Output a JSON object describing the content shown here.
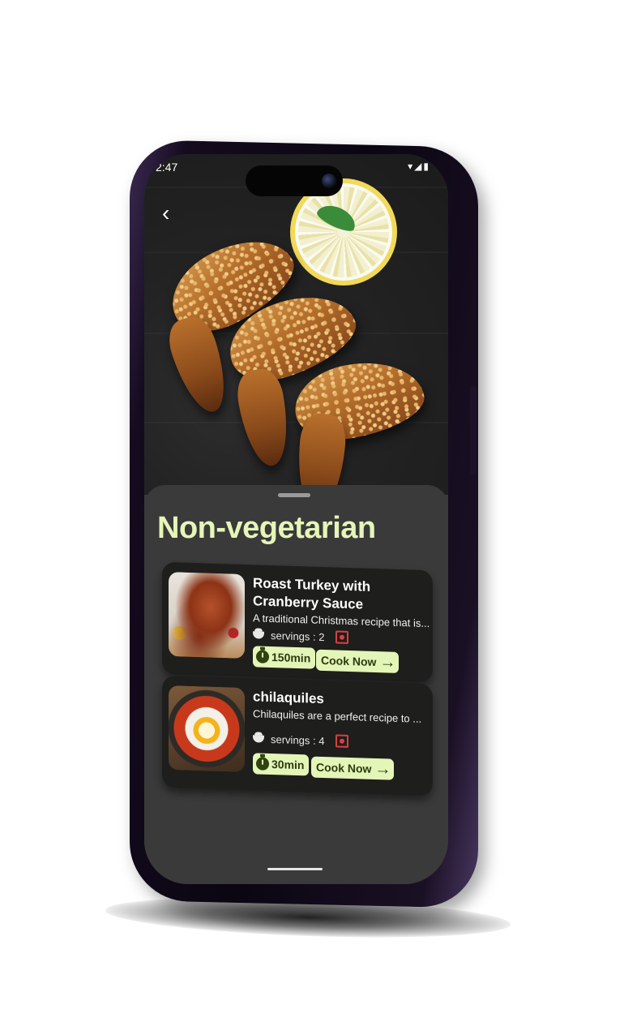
{
  "status_bar": {
    "time": "2:47",
    "icons": "▾◢▮"
  },
  "header": {
    "back_icon": "chevron-left-icon",
    "back_glyph": "‹"
  },
  "sheet": {
    "title": "Non-vegetarian"
  },
  "recipes": [
    {
      "title_line1": "Roast Turkey with",
      "title_line2": "Cranberry Sauce",
      "description": "A traditional Christmas recipe that is...",
      "servings": "servings : 2",
      "time": "150min",
      "action": "Cook Now"
    },
    {
      "title_line1": "chilaquiles",
      "description": "Chilaquiles are a perfect recipe to ...",
      "servings": "servings : 4",
      "time": "30min",
      "action": "Cook Now"
    }
  ],
  "colors": {
    "accent": "#e4f5b8",
    "title": "#e6f5b8",
    "sheet_bg": "#3a3a3a",
    "card_bg": "#1e1e1c",
    "nonveg": "#d94040"
  }
}
